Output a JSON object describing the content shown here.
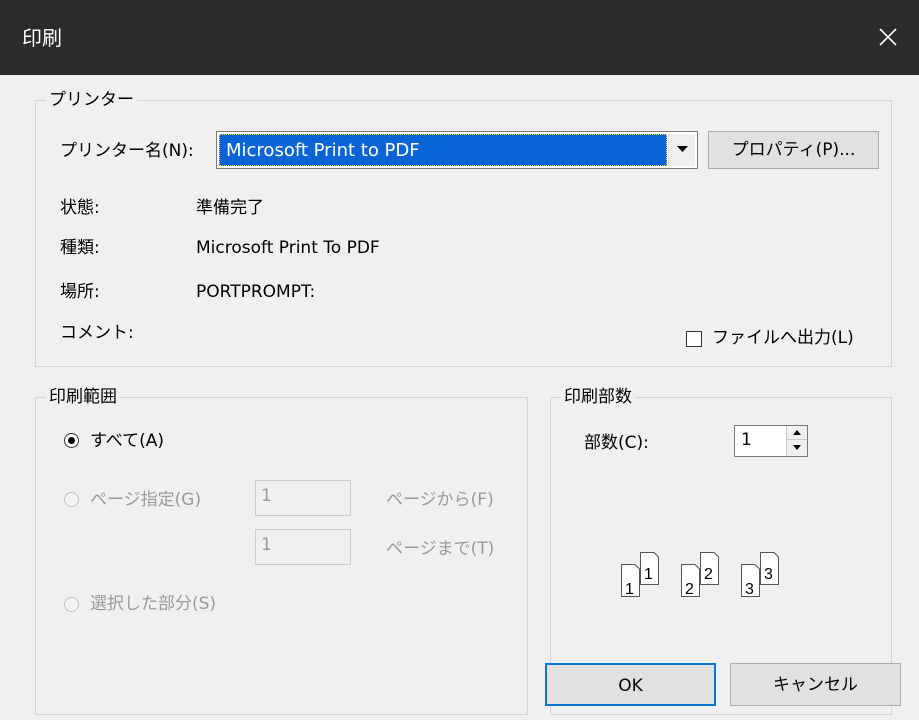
{
  "window": {
    "title": "印刷"
  },
  "printer_group": {
    "legend": "プリンター",
    "name_label": "プリンター名(N):",
    "selected_printer": "Microsoft Print to PDF",
    "properties_button": "プロパティ(P)...",
    "status_label": "状態:",
    "status_value": "準備完了",
    "type_label": "種類:",
    "type_value": "Microsoft Print To PDF",
    "location_label": "場所:",
    "location_value": "PORTPROMPT:",
    "comment_label": "コメント:",
    "print_to_file_label": "ファイルへ出力(L)"
  },
  "range_group": {
    "legend": "印刷範囲",
    "all_label": "すべて(A)",
    "pages_label": "ページ指定(G)",
    "from_value": "1",
    "from_label": "ページから(F)",
    "to_value": "1",
    "to_label": "ページまで(T)",
    "selection_label": "選択した部分(S)"
  },
  "copies_group": {
    "legend": "印刷部数",
    "copies_label": "部数(C):",
    "copies_value": "1",
    "collate_digits": [
      "1",
      "1",
      "2",
      "2",
      "3",
      "3"
    ]
  },
  "buttons": {
    "ok": "OK",
    "cancel": "キャンセル"
  }
}
